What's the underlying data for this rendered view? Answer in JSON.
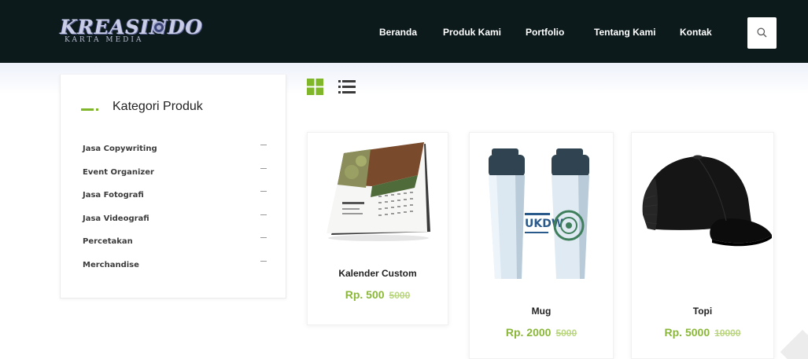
{
  "brand": {
    "name": "KREASINDO",
    "tagline": "KARTA MEDIA"
  },
  "nav": {
    "items": [
      "Beranda",
      "Produk Kami",
      "Portfolio",
      "Tentang Kami",
      "Kontak"
    ]
  },
  "sidebar": {
    "title": "Kategori Produk",
    "categories": [
      "Jasa Copywriting",
      "Event Organizer",
      "Jasa Fotografi",
      "Jasa Videografi",
      "Percetakan",
      "Merchandise"
    ]
  },
  "products": [
    {
      "name": "Kalender Custom",
      "price": "Rp. 500",
      "old_price": "5000"
    },
    {
      "name": "Mug",
      "price": "Rp. 2000",
      "old_price": "5000"
    },
    {
      "name": "Topi",
      "price": "Rp. 5000",
      "old_price": "10000"
    }
  ],
  "mug_print_text": "UKDW",
  "colors": {
    "header_bg": "#0c1a1b",
    "accent": "#7fb62a",
    "price": "#8ab73a"
  },
  "icons": {
    "search": "search-icon",
    "grid_view": "grid-view-icon",
    "list_view": "list-view-icon"
  }
}
